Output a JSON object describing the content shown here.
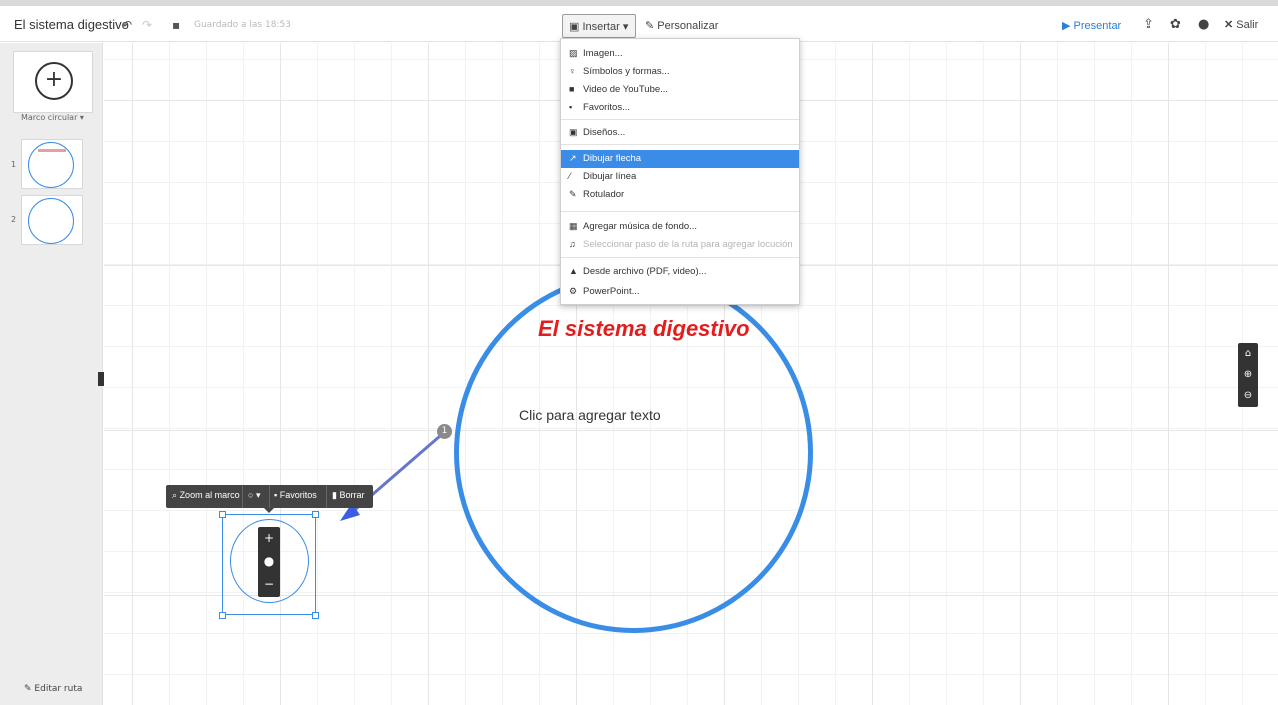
{
  "toolbar": {
    "title": "El sistema digestivo",
    "saved": "Guardado a las 18:53",
    "insert_label": "Insertar",
    "customize_label": "Personalizar",
    "present_label": "Presentar",
    "exit_label": "Salir"
  },
  "sidebar": {
    "frame_type": "Marco circular",
    "thumbs": [
      {
        "num": "1"
      },
      {
        "num": "2"
      }
    ],
    "edit_route": "Editar ruta"
  },
  "canvas": {
    "title": "El sistema digestivo",
    "placeholder_text": "Clic para agregar texto",
    "step_number": "1",
    "title_color": "#e31d1d",
    "ring_color": "#3a8de6"
  },
  "context_bar": {
    "zoom_label": "Zoom al marco",
    "favorites_label": "Favoritos",
    "delete_label": "Borrar"
  },
  "insert_menu": {
    "items": [
      {
        "label": "Imagen...",
        "icon": "image-icon"
      },
      {
        "label": "Símbolos y formas...",
        "icon": "shapes-icon"
      },
      {
        "label": "Video de YouTube...",
        "icon": "youtube-icon"
      },
      {
        "label": "Favoritos...",
        "icon": "favorites-icon"
      },
      {
        "label": "Diseños...",
        "icon": "layouts-icon"
      },
      {
        "label": "Dibujar flecha",
        "icon": "arrow-icon"
      },
      {
        "label": "Dibujar línea",
        "icon": "line-icon"
      },
      {
        "label": "Rotulador",
        "icon": "marker-icon"
      },
      {
        "label": "Agregar música de fondo...",
        "icon": "music-icon"
      },
      {
        "label": "Seleccionar paso de la ruta para agregar locución",
        "icon": "voiceover-icon"
      },
      {
        "label": "Desde archivo (PDF, video)...",
        "icon": "file-icon"
      },
      {
        "label": "PowerPoint...",
        "icon": "powerpoint-icon"
      }
    ],
    "active_item": "Dibujar flecha"
  }
}
